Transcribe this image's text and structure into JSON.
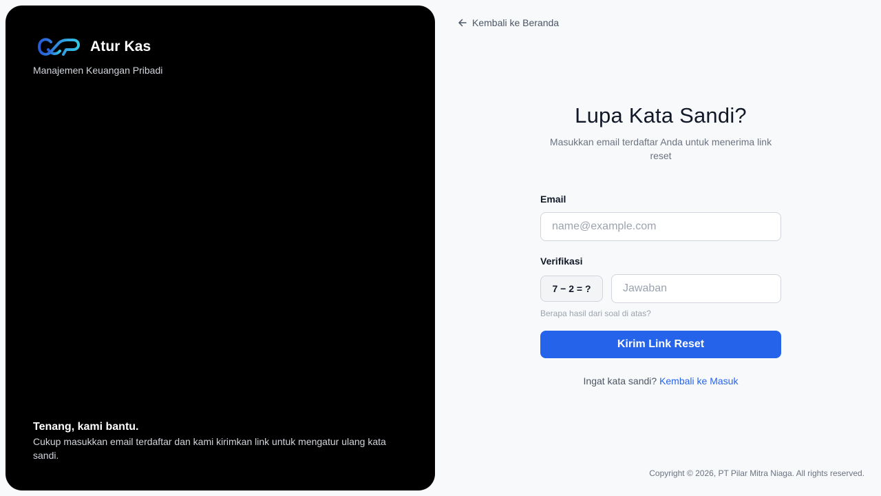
{
  "brand": {
    "logo_icon": "atur-kas-logo-icon",
    "name": "Atur Kas",
    "tagline": "Manajemen Keuangan Pribadi"
  },
  "left_footer": {
    "title": "Tenang, kami bantu.",
    "text": "Cukup masukkan email terdaftar dan kami kirimkan link untuk mengatur ulang kata sandi."
  },
  "nav": {
    "back_icon": "arrow-left-icon",
    "back_label": "Kembali ke Beranda"
  },
  "form": {
    "title": "Lupa Kata Sandi?",
    "subtitle": "Masukkan email terdaftar Anda untuk menerima link reset",
    "email_label": "Email",
    "email_value": "",
    "email_placeholder": "name@example.com",
    "verification_label": "Verifikasi",
    "captcha_question": "7 − 2 = ?",
    "answer_value": "",
    "answer_placeholder": "Jawaban",
    "hint": "Berapa hasil dari soal di atas?",
    "submit_label": "Kirim Link Reset",
    "remember_text": "Ingat kata sandi?",
    "login_link": "Kembali ke Masuk"
  },
  "footer": {
    "copyright": "Copyright © 2026, PT Pilar Mitra Niaga. All rights reserved."
  },
  "colors": {
    "accent": "#2563eb",
    "panel": "#000000",
    "background": "#f8f9fb",
    "logo_gradient_start": "#2a5bd7",
    "logo_gradient_end": "#35c6e6"
  }
}
